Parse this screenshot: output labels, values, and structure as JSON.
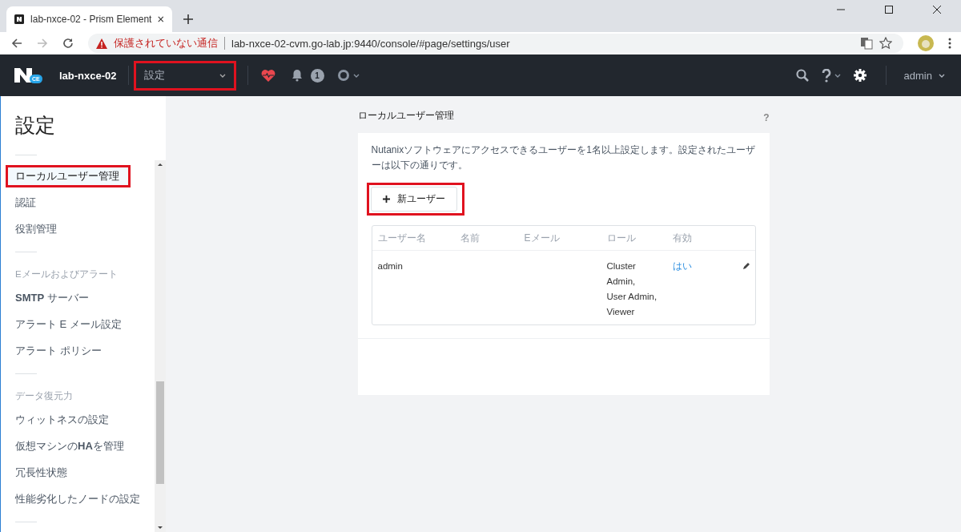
{
  "browser": {
    "tab_title": "lab-nxce-02 - Prism Element",
    "security": "保護されていない通信",
    "url": "lab-nxce-02-cvm.go-lab.jp:9440/console/#page/settings/user"
  },
  "header": {
    "logo_badge": "CE",
    "cluster": "lab-nxce-02",
    "page_menu": {
      "label": "設定",
      "highlighted": true
    },
    "alerts_count": "1",
    "user": "admin"
  },
  "sidebar": {
    "title": "設定",
    "groups": [
      {
        "items": [
          {
            "label": "ローカルユーザー管理",
            "selected": true,
            "highlighted": true
          },
          {
            "label": "認証",
            "selected": false,
            "highlighted": false
          },
          {
            "label": "役割管理",
            "selected": false,
            "highlighted": false
          }
        ]
      },
      {
        "heading": "Eメールおよびアラート",
        "items": [
          {
            "label": "**SMTP** サーバー",
            "selected": false,
            "highlighted": false
          },
          {
            "label": "アラート E メール設定",
            "selected": false,
            "highlighted": false
          },
          {
            "label": "アラート ポリシー",
            "selected": false,
            "highlighted": false
          }
        ]
      },
      {
        "heading": "データ復元力",
        "items": [
          {
            "label": "ウィットネスの設定",
            "selected": false,
            "highlighted": false
          },
          {
            "label": "仮想マシンの**HA**を管理",
            "selected": false,
            "highlighted": false
          },
          {
            "label": "冗長性状態",
            "selected": false,
            "highlighted": false
          },
          {
            "label": "性能劣化したノードの設定",
            "selected": false,
            "highlighted": false
          }
        ]
      }
    ]
  },
  "main": {
    "title": "ローカルユーザー管理",
    "help": "?",
    "description": "Nutanixソフトウェアにアクセスできるユーザーを1名以上設定します。設定されたユーザーは以下の通りです。",
    "new_user_button": {
      "label": "新ユーザー",
      "highlighted": true
    },
    "table": {
      "columns": [
        "ユーザー名",
        "名前",
        "Eメール",
        "ロール",
        "有効"
      ],
      "rows": [
        {
          "username": "admin",
          "roles": "Cluster Admin, User Admin, Viewer",
          "enabled": "はい"
        }
      ]
    }
  }
}
